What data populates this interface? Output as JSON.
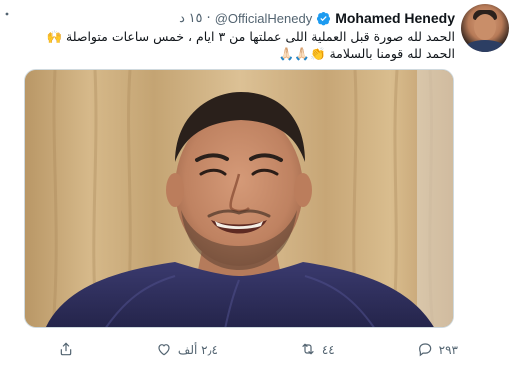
{
  "header": {
    "name": "Mohamed Henedy",
    "handle": "@OfficialHenedy",
    "separator": "·",
    "time": "١٥ د"
  },
  "tweet": {
    "lines": [
      "الحمد لله صورة قبل العملية اللى عملتها من ٣ ايام ، خمس ساعات متواصلة 🙌",
      "الحمد لله قومنا بالسلامة 👏🙏🏻🙏🏻"
    ]
  },
  "actions": {
    "reply": {
      "icon": "reply-icon",
      "count": "٢٩٣"
    },
    "retweet": {
      "icon": "retweet-icon",
      "count": "٤٤"
    },
    "like": {
      "icon": "like-icon",
      "count": "٢٫٤ ألف"
    },
    "share": {
      "icon": "share-icon"
    }
  },
  "colors": {
    "text": "#0f1419",
    "secondary": "#536471",
    "verified": "#1d9bf0",
    "border": "#cfd9de"
  }
}
